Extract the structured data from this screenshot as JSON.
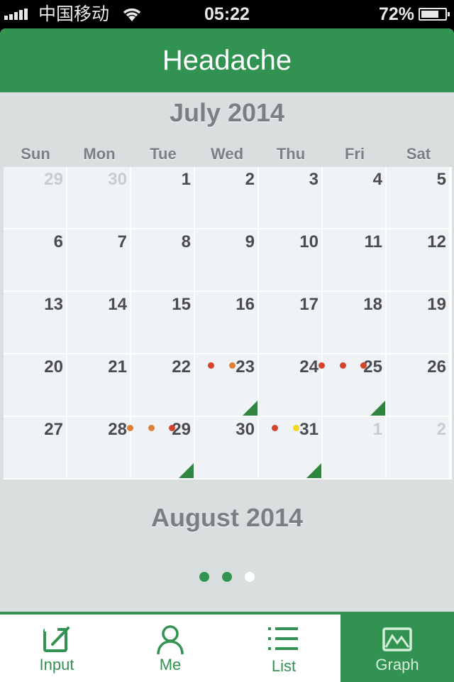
{
  "status_bar": {
    "carrier": "中国移动",
    "time": "05:22",
    "battery_percent": "72%",
    "battery_level": 0.72,
    "signal_bars": 5,
    "wifi_icon": "wifi-icon"
  },
  "header": {
    "title": "Headache"
  },
  "calendar": {
    "current_month": "July 2014",
    "next_month": "August 2014",
    "weekdays": [
      "Sun",
      "Mon",
      "Tue",
      "Wed",
      "Thu",
      "Fri",
      "Sat"
    ],
    "weeks": [
      [
        {
          "d": "29",
          "other": true
        },
        {
          "d": "30",
          "other": true
        },
        {
          "d": "1"
        },
        {
          "d": "2"
        },
        {
          "d": "3"
        },
        {
          "d": "4"
        },
        {
          "d": "5"
        }
      ],
      [
        {
          "d": "6"
        },
        {
          "d": "7"
        },
        {
          "d": "8"
        },
        {
          "d": "9"
        },
        {
          "d": "10"
        },
        {
          "d": "11"
        },
        {
          "d": "12"
        }
      ],
      [
        {
          "d": "13"
        },
        {
          "d": "14"
        },
        {
          "d": "15"
        },
        {
          "d": "16"
        },
        {
          "d": "17"
        },
        {
          "d": "18"
        },
        {
          "d": "19"
        }
      ],
      [
        {
          "d": "20"
        },
        {
          "d": "21"
        },
        {
          "d": "22"
        },
        {
          "d": "23",
          "dots": [
            "#d4442c",
            "#e07f3a"
          ],
          "marked": true
        },
        {
          "d": "24"
        },
        {
          "d": "25",
          "dots": [
            "#d4442c",
            "#d4442c",
            "#d4442c"
          ],
          "marked": true
        },
        {
          "d": "26"
        }
      ],
      [
        {
          "d": "27"
        },
        {
          "d": "28"
        },
        {
          "d": "29",
          "dots": [
            "#e07f3a",
            "#e07f3a",
            "#d4442c"
          ],
          "marked": true
        },
        {
          "d": "30"
        },
        {
          "d": "31",
          "dots": [
            "#d4442c",
            "#f7d81f"
          ],
          "marked": true
        },
        {
          "d": "1",
          "other": true
        },
        {
          "d": "2",
          "other": true
        }
      ]
    ],
    "marker_color": "#2f8540"
  },
  "pager": {
    "total": 3,
    "active_indices": [
      0,
      1
    ]
  },
  "tabbar": {
    "tabs": [
      {
        "label": "Input",
        "icon": "edit-icon",
        "active": false
      },
      {
        "label": "Me",
        "icon": "person-icon",
        "active": false
      },
      {
        "label": "List",
        "icon": "list-icon",
        "active": false
      },
      {
        "label": "Graph",
        "icon": "graph-icon",
        "active": true
      }
    ]
  },
  "colors": {
    "brand": "#329252",
    "background": "#d9dfdf",
    "cell": "#f0f3f6"
  }
}
